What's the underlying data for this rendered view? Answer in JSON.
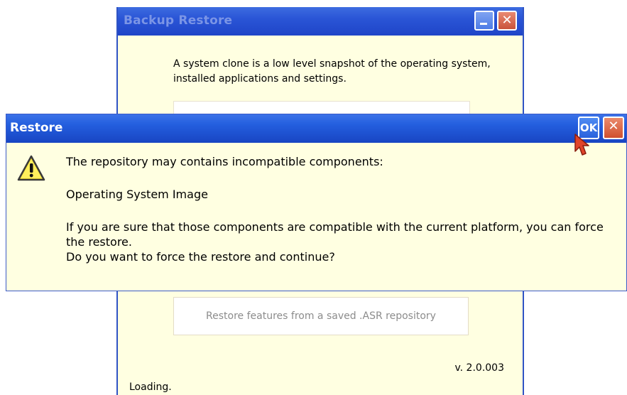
{
  "background_window": {
    "title": "Backup Restore",
    "description": "A system clone is a low level snapshot of the operating system, installed applications and settings.",
    "restore_button_label": "Restore features from a saved .ASR repository",
    "version": "v. 2.0.003",
    "status": "Loading.",
    "minimize_icon": "minimize-icon",
    "close_icon": "close-icon"
  },
  "dialog": {
    "title": "Restore",
    "ok_label": "OK",
    "close_glyph": "✕",
    "icon": "warning-icon",
    "message_line1": "The repository may contains incompatible components:",
    "message_component": "Operating System Image",
    "message_question": "If you are sure that those components are compatible with the current platform, you can force the restore.\nDo you want to force the restore and continue?"
  },
  "colors": {
    "window_bg": "#ffffe1",
    "titlebar_blue": "#245fdf",
    "close_red": "#d0502e",
    "cursor_red": "#e0442a"
  }
}
